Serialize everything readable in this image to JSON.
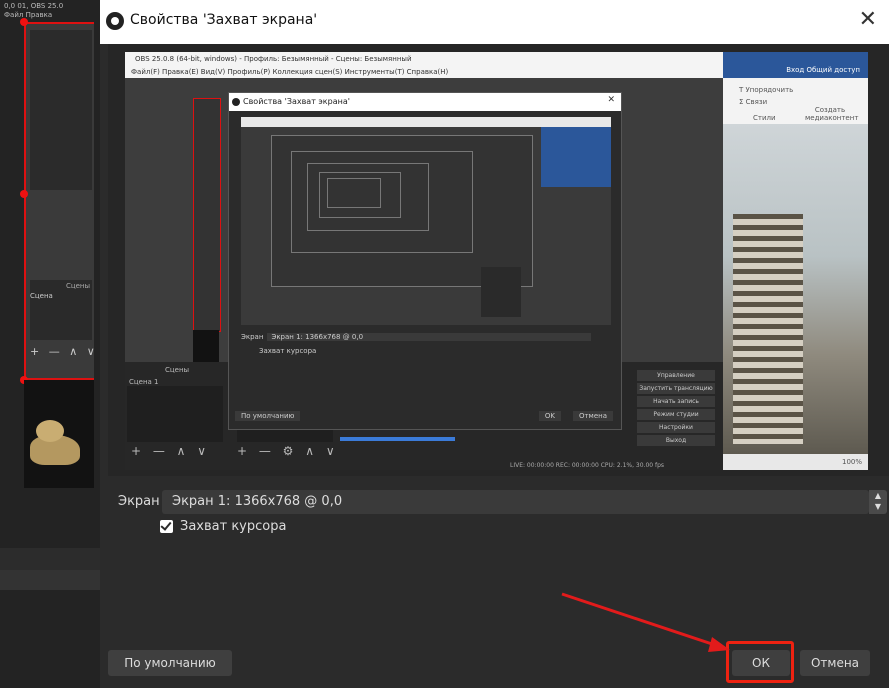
{
  "dialog": {
    "title": "Свойства 'Захват экрана'",
    "close_glyph": "✕"
  },
  "background_window": {
    "title_text": "0,0 01, OBS 25.0",
    "menu_text": "Файл  Правка",
    "scenes_header": "Сцены",
    "scene_item": "Сцена",
    "controls": "+ — ∧ ∨"
  },
  "preview": {
    "capture_title": "OBS 25.0.8 (64-bit, windows) - Профиль: Безымянный - Сцены: Безымянный",
    "capture_menu": "Файл(F)  Правка(E)  Вид(V)  Профиль(P)  Коллекция сцен(S)  Инструменты(T)  Справка(H)",
    "ribbon_share": "Вход  Общий доступ",
    "ribbon_t1": "Т Упорядочить",
    "ribbon_t2": "Σ Связи",
    "ribbon_t3": "Стили",
    "ribbon_t4": "Создать медиаконтент",
    "doc_status": "100%",
    "nested_title": "Свойства 'Захват экрана'",
    "nested_close": "✕",
    "nested_screen_label": "Экран",
    "nested_screen_value": "Экран 1: 1366x768 @ 0,0",
    "nested_cursor": "Захват курсора",
    "nested_default": "По умолчанию",
    "nested_ok": "OK",
    "nested_cancel": "Отмена",
    "scenes_label": "Сцены",
    "scene_1": "Сцена 1",
    "controls_1": "+ — ∧ ∨",
    "controls_2": "+ — ⚙ ∧ ∨",
    "control_buttons": [
      "Управление",
      "Запустить трансляцию",
      "Начать запись",
      "Режим студии",
      "Настройки",
      "Выход"
    ],
    "status_line": "LIVE: 00:00:00   REC: 00:00:00   CPU: 2.1%, 30.00 fps"
  },
  "form": {
    "screen_label": "Экран",
    "screen_value": "Экран 1: 1366x768 @ 0,0",
    "cursor_label": "Захват курсора",
    "cursor_checked": true
  },
  "buttons": {
    "default_label": "По умолчанию",
    "ok_label": "ОК",
    "cancel_label": "Отмена"
  },
  "annotation": {
    "color": "#e21b1b"
  }
}
